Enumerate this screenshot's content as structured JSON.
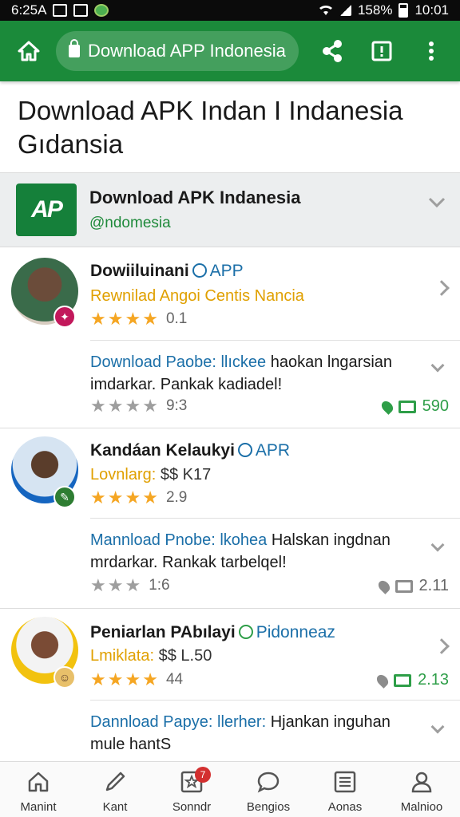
{
  "status_bar": {
    "time_left": "6:25A",
    "battery": "158%",
    "time_right": "10:01"
  },
  "app_bar": {
    "url": "Download APP Indonesia"
  },
  "page": {
    "title_line1": "Download APK Indan I Indanesia",
    "title_line2": "Gıdansia"
  },
  "featured": {
    "logo_text": "AP",
    "title": "Download APK Indanesia",
    "subtitle": "@ndomesia"
  },
  "entries": [
    {
      "name": "Dowiiluinani",
      "tag": "APP",
      "subtitle": "Rewnilad Angoi Centis Nancia",
      "subtitle_color": "#e0a000",
      "rating": "0.1",
      "desc_lead": "Download Paobe: llıckee",
      "desc_rest": " haokan lngarsian",
      "desc_line2": "imdarkar. Pankak kadiadel!",
      "rating2": "9:3",
      "count": "590",
      "meta_style": "green"
    },
    {
      "name": "Kandáan Kelaukyi",
      "tag": "APR",
      "subtitle_prefix": "Lovnlarg:",
      "subtitle": " $$ K17",
      "subtitle_color": "#e0a000",
      "rating": "2.9",
      "desc_lead": "Mannload Pnobe: lkohea",
      "desc_rest": " Halskan ingdnan",
      "desc_line2": "mrdarkar. Rankak tarbelqel!",
      "rating2": "1:6",
      "count": "2.11",
      "meta_style": "gray"
    },
    {
      "name": "Peniarlan PAbılayi",
      "tag": "Pidonneaz",
      "subtitle_prefix": "Lmiklata:",
      "subtitle": " $$ L.50",
      "subtitle_color": "#e0a000",
      "rating": "44",
      "desc_lead": "Dannload Papye: llerher:",
      "desc_rest": " Hjankan inguhan",
      "desc_line2": "mule hantS",
      "count": "2.13",
      "meta_style": "green"
    }
  ],
  "bottom_nav": {
    "items": [
      {
        "label": "Manint",
        "icon": "home-icon"
      },
      {
        "label": "Kant",
        "icon": "pen-icon"
      },
      {
        "label": "Sonndr",
        "icon": "star-box-icon",
        "badge": "7"
      },
      {
        "label": "Bengios",
        "icon": "chat-icon"
      },
      {
        "label": "Aonas",
        "icon": "list-icon"
      },
      {
        "label": "Malnioo",
        "icon": "person-icon"
      }
    ]
  },
  "colors": {
    "brand_green": "#1b8a3a",
    "link_blue": "#1b6fa8",
    "star_gold": "#f5a623"
  }
}
